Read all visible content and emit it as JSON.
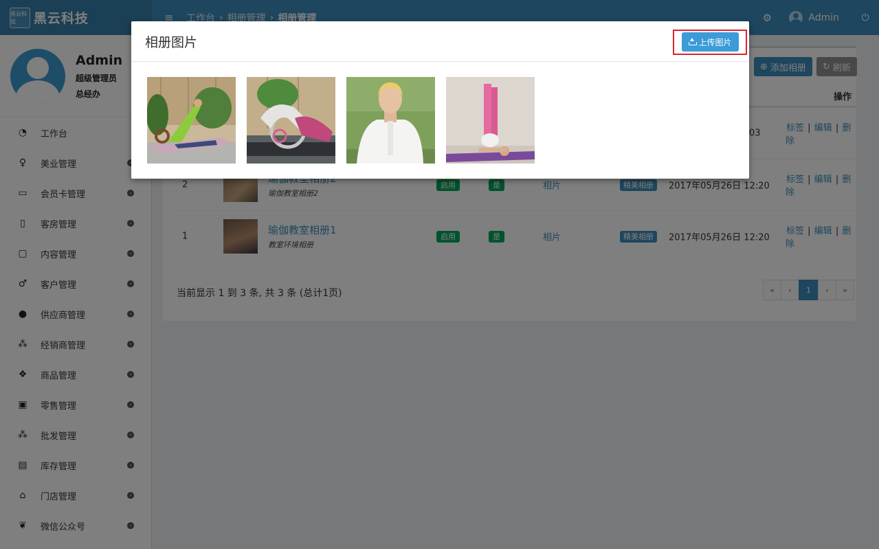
{
  "brand": {
    "logo_text": "黑云科技",
    "name": "黑云科技"
  },
  "header": {
    "breadcrumb": [
      "工作台",
      "相册管理",
      "相册管理"
    ],
    "user_name": "Admin"
  },
  "sidebar": {
    "user": {
      "name": "Admin",
      "role": "超级管理员",
      "dept": "总经办"
    },
    "items": [
      {
        "label": "工作台",
        "icon": "dashboard-icon",
        "glyph": "◔"
      },
      {
        "label": "美业管理",
        "icon": "female-icon",
        "glyph": "♀"
      },
      {
        "label": "会员卡管理",
        "icon": "credit-card-icon",
        "glyph": "▭"
      },
      {
        "label": "客房管理",
        "icon": "tablet-icon",
        "glyph": "▯"
      },
      {
        "label": "内容管理",
        "icon": "file-icon",
        "glyph": "▢"
      },
      {
        "label": "客户管理",
        "icon": "male-icon",
        "glyph": "♂"
      },
      {
        "label": "供应商管理",
        "icon": "user-icon",
        "glyph": "●"
      },
      {
        "label": "经销商管理",
        "icon": "users-icon",
        "glyph": "⁂"
      },
      {
        "label": "商品管理",
        "icon": "cubes-icon",
        "glyph": "❖"
      },
      {
        "label": "零售管理",
        "icon": "money-icon",
        "glyph": "▣"
      },
      {
        "label": "批发管理",
        "icon": "group-icon",
        "glyph": "⁂"
      },
      {
        "label": "库存管理",
        "icon": "archive-icon",
        "glyph": "▤"
      },
      {
        "label": "门店管理",
        "icon": "home-icon",
        "glyph": "⌂"
      },
      {
        "label": "微信公众号",
        "icon": "wechat-icon",
        "glyph": "❦"
      }
    ]
  },
  "toolbar": {
    "add_label": "添加相册",
    "refresh_label": "刷新"
  },
  "table": {
    "actions_header": "操作",
    "row0_time_fragment": "03",
    "rows": [
      {
        "index": "2",
        "title": "瑜伽教室相册2",
        "subtitle": "瑜伽教室相册2",
        "status": "启用",
        "flag": "是",
        "link": "相片",
        "category": "精美相册",
        "time": "2017年05月26日 12:20"
      },
      {
        "index": "1",
        "title": "瑜伽教室相册1",
        "subtitle": "教室环境相册",
        "status": "启用",
        "flag": "是",
        "link": "相片",
        "category": "精美相册",
        "time": "2017年05月26日 12:20"
      }
    ],
    "action_links": {
      "tag": "标签",
      "edit": "编辑",
      "delete": "删除"
    }
  },
  "pagination": {
    "info": "当前显示 1 到 3 条, 共 3 条 (总计1页)",
    "first": "«",
    "prev": "‹",
    "current": "1",
    "next": "›",
    "last": "»"
  },
  "modal": {
    "title": "相册图片",
    "upload_label": "上传图片",
    "highlight_color": "#d9232e"
  },
  "colors": {
    "primary": "#3c8dbc",
    "success": "#00a65a",
    "overlay": "rgba(0,0,0,0.5)"
  }
}
